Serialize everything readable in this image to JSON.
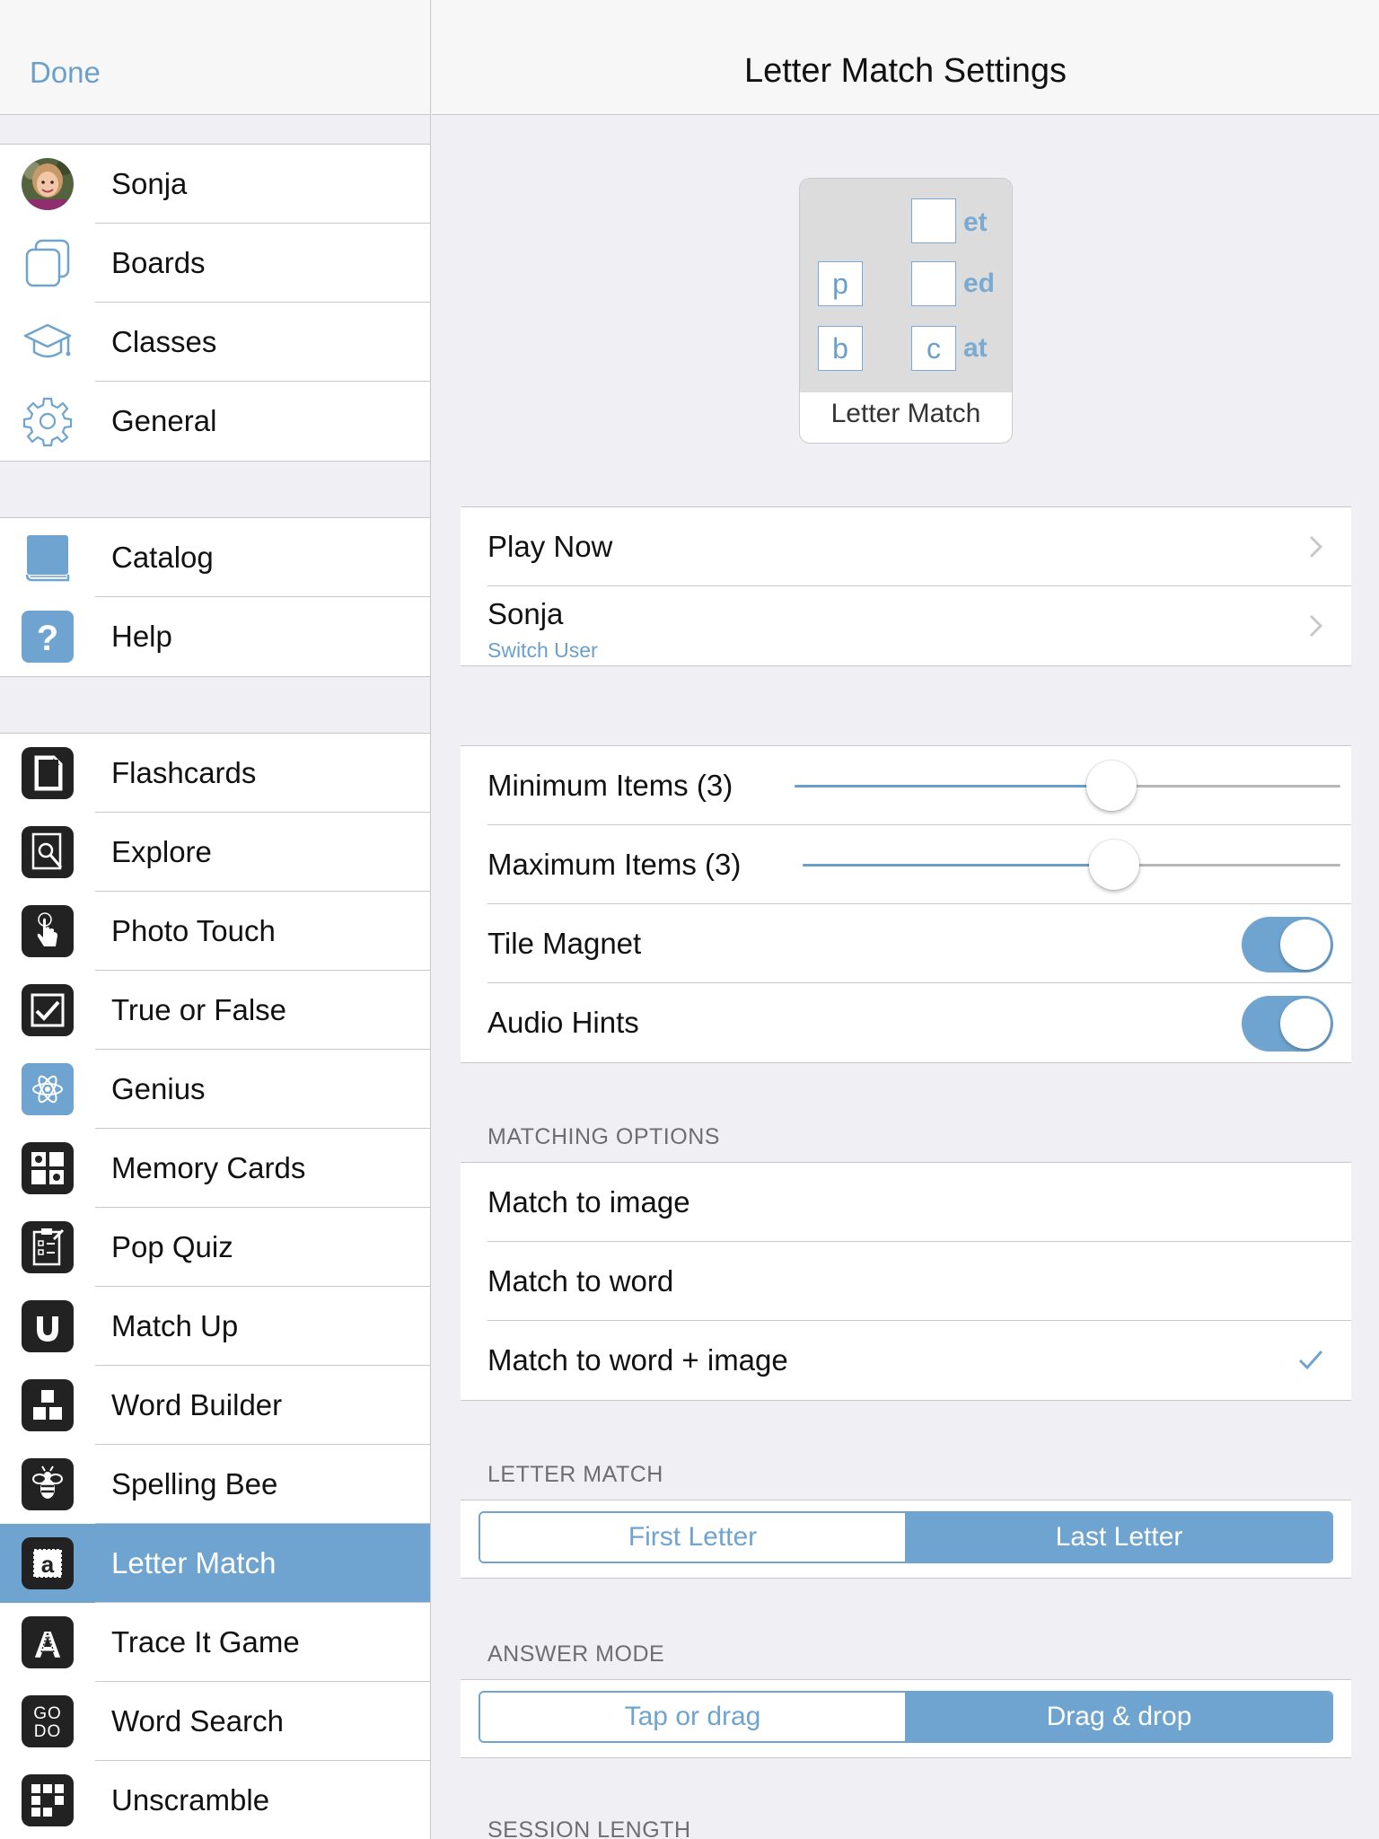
{
  "sidebar": {
    "done_label": "Done",
    "group1": [
      {
        "label": "Sonja",
        "icon": "avatar"
      },
      {
        "label": "Boards",
        "icon": "boards-icon"
      },
      {
        "label": "Classes",
        "icon": "graduation-cap-icon"
      },
      {
        "label": "General",
        "icon": "gear-icon"
      }
    ],
    "group2": [
      {
        "label": "Catalog",
        "icon": "book-icon"
      },
      {
        "label": "Help",
        "icon": "question-icon"
      }
    ],
    "group3": [
      {
        "label": "Flashcards",
        "icon": "flashcard-icon"
      },
      {
        "label": "Explore",
        "icon": "magnifier-icon"
      },
      {
        "label": "Photo Touch",
        "icon": "touch-hand-icon"
      },
      {
        "label": "True or False",
        "icon": "checkbox-icon"
      },
      {
        "label": "Genius",
        "icon": "atom-icon"
      },
      {
        "label": "Memory Cards",
        "icon": "memory-grid-icon"
      },
      {
        "label": "Pop Quiz",
        "icon": "quiz-clipboard-icon"
      },
      {
        "label": "Match Up",
        "icon": "magnet-icon"
      },
      {
        "label": "Word Builder",
        "icon": "blocks-icon"
      },
      {
        "label": "Spelling Bee",
        "icon": "bee-icon"
      },
      {
        "label": "Letter Match",
        "icon": "letter-a-icon",
        "selected": true
      },
      {
        "label": "Trace It Game",
        "icon": "letter-A-trace-icon"
      },
      {
        "label": "Word Search",
        "icon": "word-search-icon",
        "glyph": "GO\nDO"
      },
      {
        "label": "Unscramble",
        "icon": "unscramble-grid-icon"
      }
    ]
  },
  "main": {
    "title": "Letter Match Settings",
    "preview": {
      "caption": "Letter Match",
      "tiles": [
        "p",
        "b",
        "c"
      ],
      "suffixes": [
        "et",
        "ed",
        "at"
      ]
    },
    "actions": {
      "play_now": "Play Now",
      "user_name": "Sonja",
      "switch_user": "Switch User"
    },
    "settings": {
      "min_items_label": "Minimum Items (3)",
      "min_items_level": 0.58,
      "max_items_label": "Maximum Items (3)",
      "max_items_level": 0.58,
      "tile_magnet_label": "Tile Magnet",
      "tile_magnet_on": true,
      "audio_hints_label": "Audio Hints",
      "audio_hints_on": true
    },
    "matching": {
      "header": "MATCHING OPTIONS",
      "options": [
        "Match to image",
        "Match to word",
        "Match to word + image"
      ],
      "selected": "Match to word + image"
    },
    "letter_match": {
      "header": "LETTER MATCH",
      "options": [
        "First Letter",
        "Last Letter"
      ],
      "selected": "Last Letter"
    },
    "answer_mode": {
      "header": "ANSWER MODE",
      "options": [
        "Tap or drag",
        "Drag & drop"
      ],
      "selected": "Drag & drop"
    },
    "session_length": {
      "header": "SESSION LENGTH"
    }
  },
  "colors": {
    "accent": "#6ea4cf",
    "link": "#6aa0c9",
    "separator": "#c8c7cc",
    "background": "#efeff4"
  }
}
